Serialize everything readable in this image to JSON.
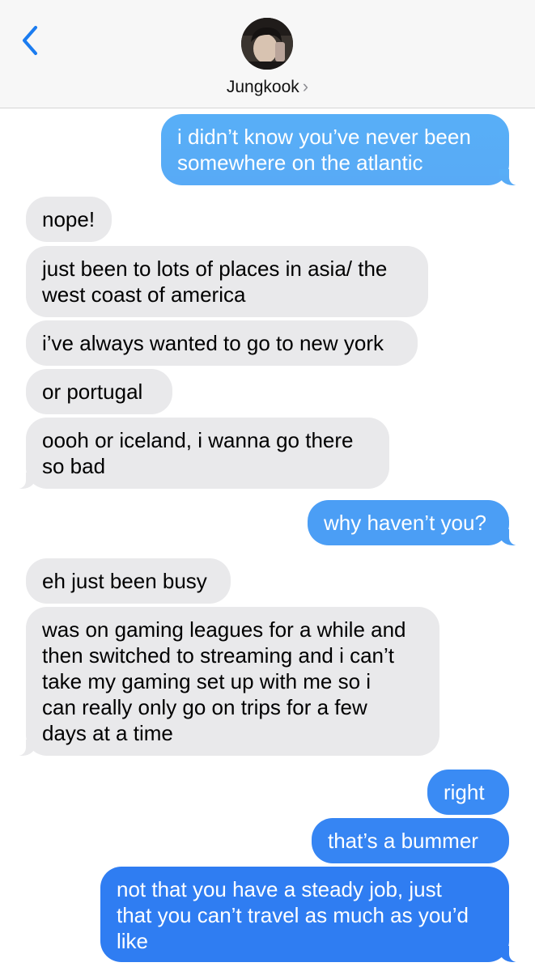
{
  "header": {
    "contact_name": "Jungkook",
    "chevron": "›",
    "back_icon": "chevron-left-icon",
    "accent_color": "#1b7cf0"
  },
  "colors": {
    "incoming_bubble": "#e9e9eb",
    "outgoing_bubble_top": "#5fb2f7",
    "outgoing_bubble_bottom": "#2e7cf2"
  },
  "messages": [
    {
      "side": "out",
      "lines": [
        "i didn’t know you’ve never been",
        "somewhere on the atlantic"
      ]
    },
    {
      "side": "in",
      "lines": [
        "nope!"
      ]
    },
    {
      "side": "in",
      "lines": [
        "just been to lots of places in asia/ the",
        "west coast of america"
      ]
    },
    {
      "side": "in",
      "lines": [
        "i’ve always wanted to go to new york"
      ]
    },
    {
      "side": "in",
      "lines": [
        "or portugal"
      ]
    },
    {
      "side": "in",
      "lines": [
        "oooh or iceland, i wanna go there",
        "so bad"
      ]
    },
    {
      "side": "out",
      "lines": [
        "why haven’t you?"
      ]
    },
    {
      "side": "in",
      "lines": [
        "eh just been busy"
      ]
    },
    {
      "side": "in",
      "lines": [
        "was on gaming leagues for a while and",
        "then switched to streaming and i can’t",
        "take my gaming set up with me so i",
        "can really only go on trips for a few",
        "days at a time"
      ]
    },
    {
      "side": "out",
      "lines": [
        "right"
      ]
    },
    {
      "side": "out",
      "lines": [
        "that’s a bummer"
      ]
    },
    {
      "side": "out",
      "lines": [
        "not that you have a steady job, just",
        "that you can’t travel as much as you’d",
        "like"
      ]
    }
  ]
}
